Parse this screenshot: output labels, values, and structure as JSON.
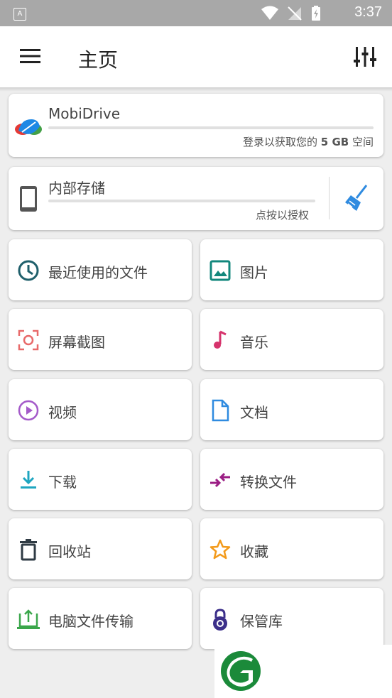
{
  "status_bar": {
    "time": "3:37",
    "notif_icon": "A"
  },
  "app_bar": {
    "title": "主页"
  },
  "mobidrive": {
    "name": "MobiDrive",
    "hint_prefix": "登录以获取您的",
    "hint_bold": "5 GB",
    "hint_suffix": "空间"
  },
  "storage": {
    "name": "内部存储",
    "hint": "点按以授权"
  },
  "tiles": [
    {
      "label": "最近使用的文件",
      "icon": "clock-icon",
      "color": "#1f5f6b"
    },
    {
      "label": "图片",
      "icon": "image-icon",
      "color": "#12877c"
    },
    {
      "label": "屏幕截图",
      "icon": "screenshot-icon",
      "color": "#e86a6a"
    },
    {
      "label": "音乐",
      "icon": "music-icon",
      "color": "#d6336c"
    },
    {
      "label": "视频",
      "icon": "video-play-icon",
      "color": "#a45ac9"
    },
    {
      "label": "文档",
      "icon": "document-icon",
      "color": "#2f8be0"
    },
    {
      "label": "下载",
      "icon": "download-icon",
      "color": "#1fa6c0"
    },
    {
      "label": "转换文件",
      "icon": "convert-icon",
      "color": "#9b1e84"
    },
    {
      "label": "回收站",
      "icon": "trash-icon",
      "color": "#2f3b44"
    },
    {
      "label": "收藏",
      "icon": "star-icon",
      "color": "#f39a1a"
    },
    {
      "label": "电脑文件传输",
      "icon": "pc-transfer-icon",
      "color": "#3aa64a"
    },
    {
      "label": "保管库",
      "icon": "vault-lock-icon",
      "color": "#3c2f8a"
    }
  ]
}
